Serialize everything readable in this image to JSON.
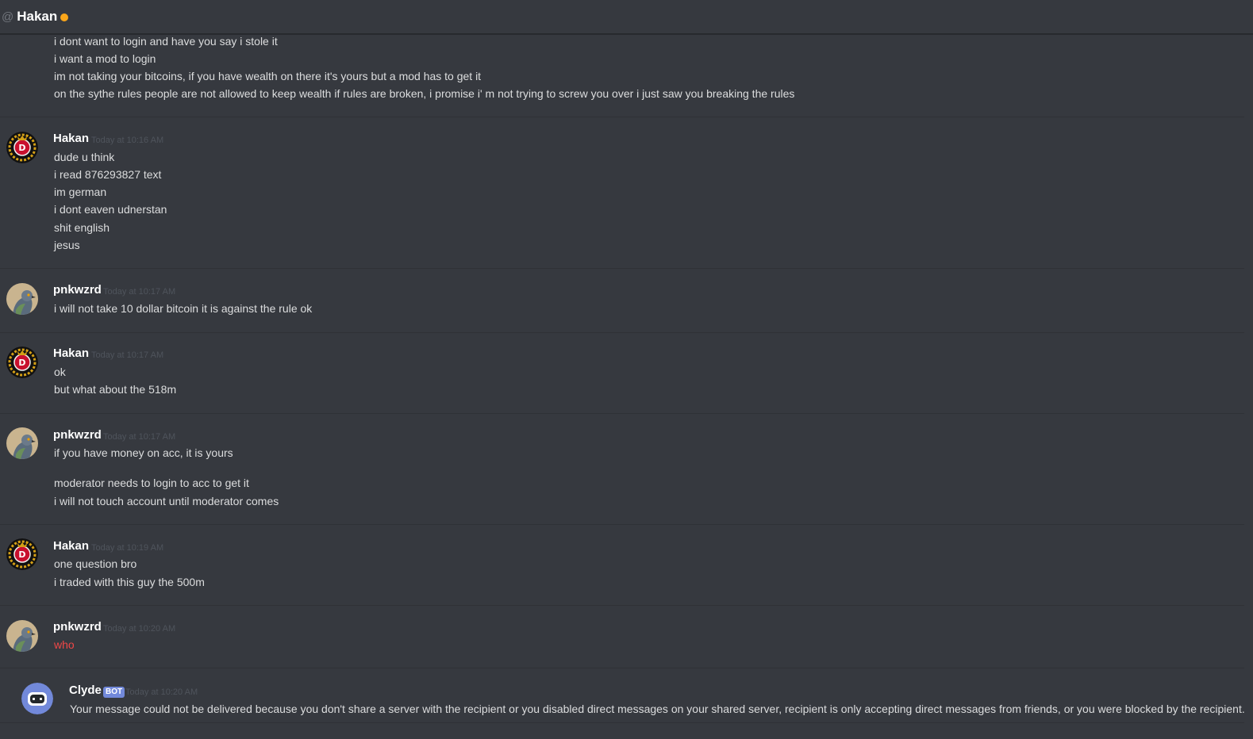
{
  "header": {
    "at_symbol": "@",
    "title": "Hakan",
    "status_color": "#faa61a"
  },
  "top_lines": [
    "i dont want to login and have you say i stole it",
    "i want a mod to login",
    "im not taking your bitcoins, if you have wealth on there it's yours but a mod has to get it",
    "on the sythe rules people are not allowed to keep wealth if rules are broken, i promise i' m not trying to screw you over i just saw you breaking the rules"
  ],
  "messages": [
    {
      "author": "Hakan",
      "timestamp": "Today at 10:16 AM",
      "lines": [
        "dude u think",
        "i read 876293827 text",
        "im german",
        "i dont eaven udnerstan",
        "shit english",
        "jesus"
      ]
    },
    {
      "author": "pnkwzrd",
      "timestamp": "Today at 10:17 AM",
      "lines": [
        "i will not take 10 dollar bitcoin it is against the rule ok"
      ]
    },
    {
      "author": "Hakan",
      "timestamp": "Today at 10:17 AM",
      "lines": [
        "ok",
        "but what about the 518m"
      ]
    },
    {
      "author": "pnkwzrd",
      "timestamp": "Today at 10:17 AM",
      "lines": [
        "if you have money on acc, it is yours",
        "moderator needs to login to acc to get it",
        "i will not touch account until moderator comes"
      ]
    },
    {
      "author": "Hakan",
      "timestamp": "Today at 10:19 AM",
      "lines": [
        "one question bro",
        "i traded with this guy the 500m"
      ]
    },
    {
      "author": "pnkwzrd",
      "timestamp": "Today at 10:20 AM",
      "lines": [
        "who"
      ]
    },
    {
      "author": "Clyde",
      "badge": "BOT",
      "timestamp": "Today at 10:20 AM",
      "lines": [
        "Your message could not be delivered because you don't share a server with the recipient or you disabled direct messages on your shared server, recipient is only accepting direct messages from friends, or you were blocked by the recipient."
      ]
    }
  ],
  "colors": {
    "background": "#36393f",
    "failed_message": "#f04747",
    "bot_badge": "#7289da"
  }
}
